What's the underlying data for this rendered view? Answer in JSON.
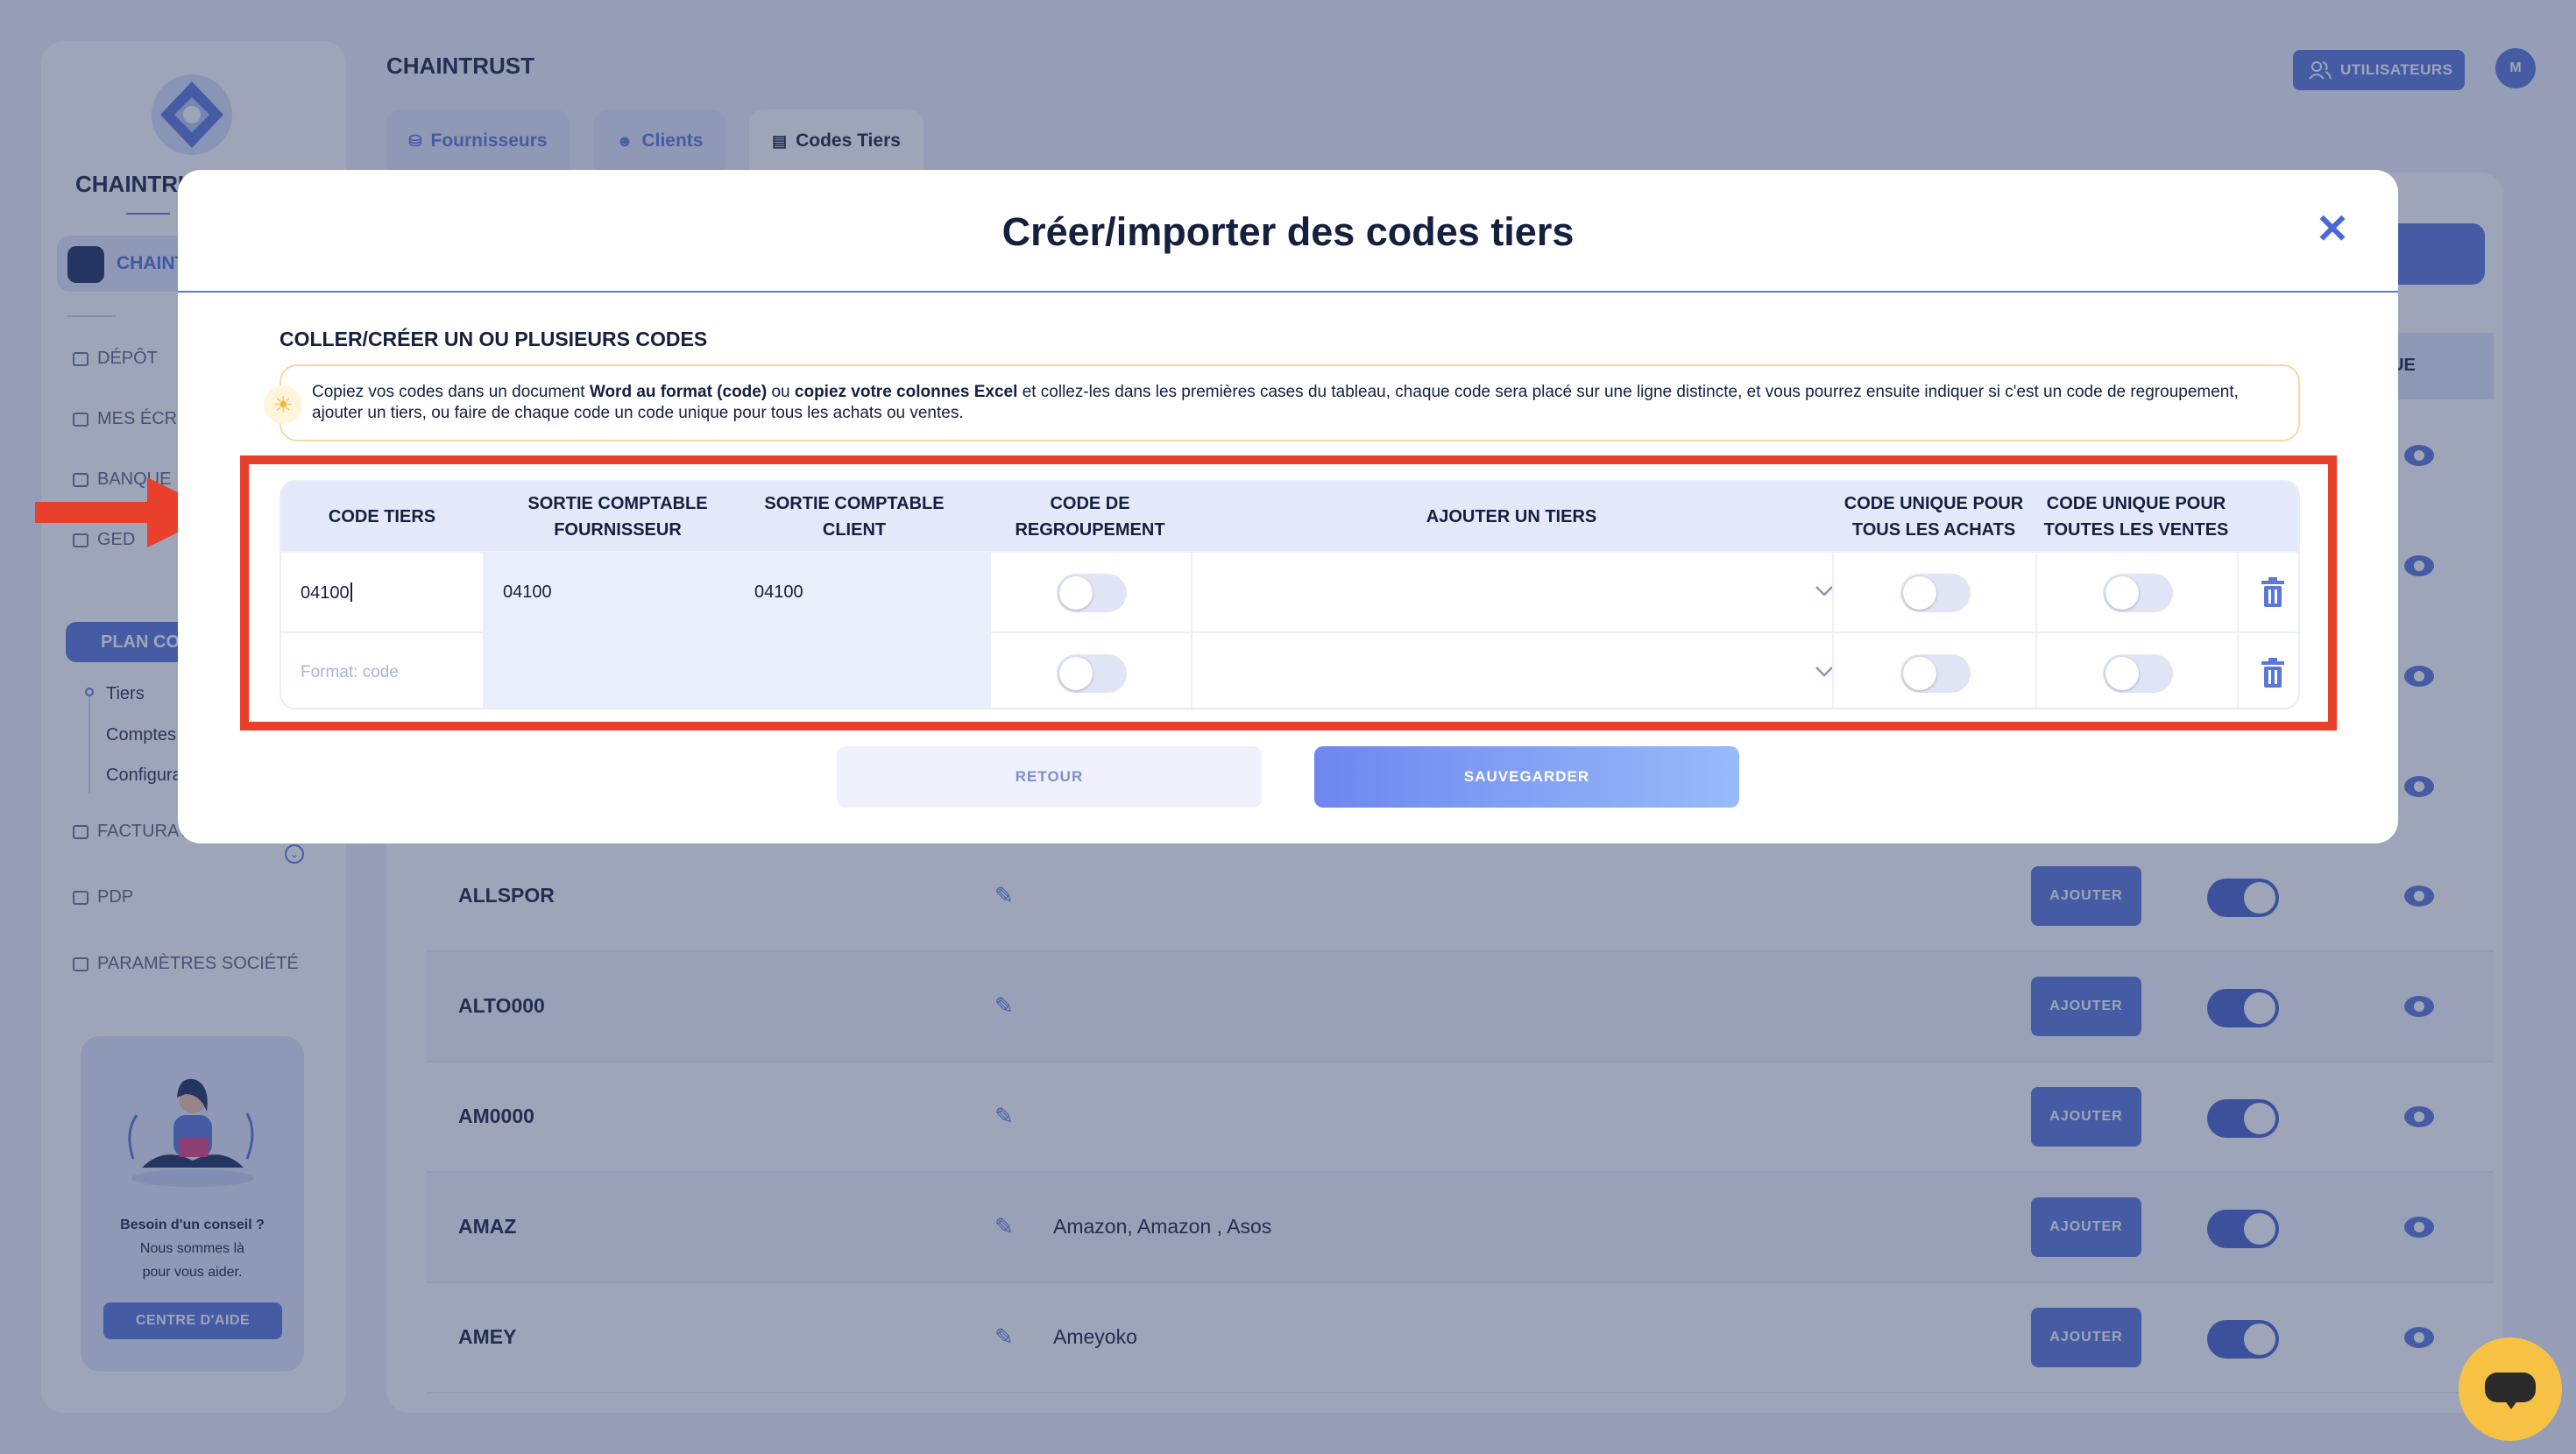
{
  "app": {
    "title": "CHAINTRUST",
    "brand": "CHAINTRUST"
  },
  "sidebar": {
    "company": "CHAINTRUST",
    "items": [
      {
        "label": "DÉPÔT",
        "icon": "folder-icon"
      },
      {
        "label": "MES ÉCRITURES",
        "icon": "folder-icon"
      },
      {
        "label": "BANQUE",
        "icon": "bank-icon"
      },
      {
        "label": "GED",
        "icon": "document-icon"
      },
      {
        "label": "PLAN COMPTABLE",
        "icon": "book-icon"
      },
      {
        "label": "FACTURATION",
        "icon": "invoice-icon"
      },
      {
        "label": "PDP",
        "icon": "card-icon"
      },
      {
        "label": "PARAMÈTRES SOCIÉTÉ",
        "icon": "sliders-icon"
      }
    ],
    "subitems": [
      "Tiers",
      "Comptes",
      "Configuration"
    ],
    "help": {
      "text_line1": "Besoin d'un conseil ?",
      "text_line2": "Nous sommes là",
      "text_line3": "pour vous aider.",
      "button": "CENTRE D'AIDE"
    }
  },
  "header": {
    "users_button": "UTILISATEURS",
    "avatar_initial": "M"
  },
  "tabs": [
    {
      "label": "Fournisseurs",
      "active": false
    },
    {
      "label": "Clients",
      "active": false
    },
    {
      "label": "Codes Tiers",
      "active": true
    }
  ],
  "background_table": {
    "header_fragment": "IQUE",
    "rows": [
      {
        "code": "ALLSPOR",
        "tiers": "",
        "add_label": "AJOUTER",
        "toggle_on": true
      },
      {
        "code": "ALTO000",
        "tiers": "",
        "add_label": "AJOUTER",
        "toggle_on": true
      },
      {
        "code": "AM0000",
        "tiers": "",
        "add_label": "AJOUTER",
        "toggle_on": true
      },
      {
        "code": "AMAZ",
        "tiers": "Amazon, Amazon , Asos",
        "add_label": "AJOUTER",
        "toggle_on": true
      },
      {
        "code": "AMEY",
        "tiers": "Ameyoko",
        "add_label": "AJOUTER",
        "toggle_on": true
      }
    ]
  },
  "modal": {
    "title": "Créer/importer des codes tiers",
    "section_title": "COLLER/CRÉER UN OU PLUSIEURS CODES",
    "hint": {
      "p1": "Copiez vos codes dans un document ",
      "b1": "Word au format (code)",
      "p2": " ou ",
      "b2": "copiez votre colonnes Excel",
      "p3": " et collez-les dans les premières cases du tableau, chaque code sera placé sur une ligne distincte, et vous pourrez ensuite indiquer si c'est un code de regroupement, ajouter un tiers, ou faire de chaque code un code unique pour tous les achats ou ventes."
    },
    "columns": {
      "code_tiers": "CODE TIERS",
      "sortie_fournisseur_1": "SORTIE COMPTABLE",
      "sortie_fournisseur_2": "FOURNISSEUR",
      "sortie_client_1": "SORTIE COMPTABLE",
      "sortie_client_2": "CLIENT",
      "regroupement_1": "CODE DE",
      "regroupement_2": "REGROUPEMENT",
      "ajouter_tiers": "AJOUTER UN TIERS",
      "unique_achats_1": "CODE UNIQUE POUR",
      "unique_achats_2": "TOUS LES ACHATS",
      "unique_ventes_1": "CODE UNIQUE POUR",
      "unique_ventes_2": "TOUTES LES VENTES"
    },
    "rows": [
      {
        "code": "04100",
        "sortie_fournisseur": "04100",
        "sortie_client": "04100",
        "regroupement": false,
        "unique_achats": false,
        "unique_ventes": false
      },
      {
        "code": "",
        "placeholder": "Format: code",
        "sortie_fournisseur": "",
        "sortie_client": "",
        "regroupement": false,
        "unique_achats": false,
        "unique_ventes": false
      }
    ],
    "back_button": "RETOUR",
    "save_button": "SAUVEGARDER"
  },
  "colors": {
    "accent": "#5b78d8",
    "highlight_frame": "#e8402b",
    "chat": "#f7c244"
  }
}
